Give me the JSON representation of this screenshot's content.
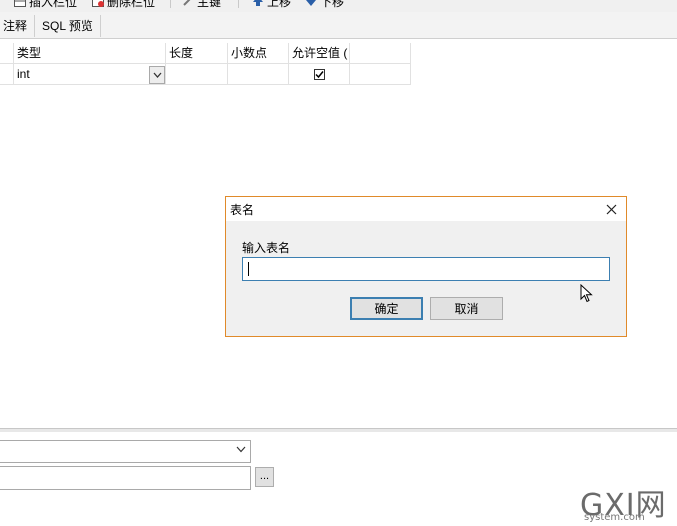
{
  "toolbar": {
    "items": [
      {
        "label": "插入栏位",
        "icon": "insert-field-icon"
      },
      {
        "label": "删除栏位",
        "icon": "delete-field-icon"
      },
      {
        "label": "主键",
        "icon": "primary-key-icon"
      },
      {
        "label": "上移",
        "icon": "move-up-icon"
      },
      {
        "label": "下移",
        "icon": "move-down-icon"
      }
    ]
  },
  "tabs": [
    {
      "label": "注释"
    },
    {
      "label": "SQL 预览"
    }
  ],
  "grid": {
    "headers": [
      "类型",
      "长度",
      "小数点",
      "允许空值 ("
    ],
    "rows": [
      {
        "type": "int",
        "length": "",
        "decimals": "",
        "allow_null": true
      }
    ]
  },
  "dialog": {
    "title": "表名",
    "label": "输入表名",
    "input_value": "",
    "ok_label": "确定",
    "cancel_label": "取消",
    "border_color": "#e08a2a"
  },
  "bottom_panel": {
    "combo_value": "",
    "text_value": "",
    "browse_label": "..."
  },
  "watermark": {
    "main": "GXI网",
    "sub": "system.com"
  }
}
